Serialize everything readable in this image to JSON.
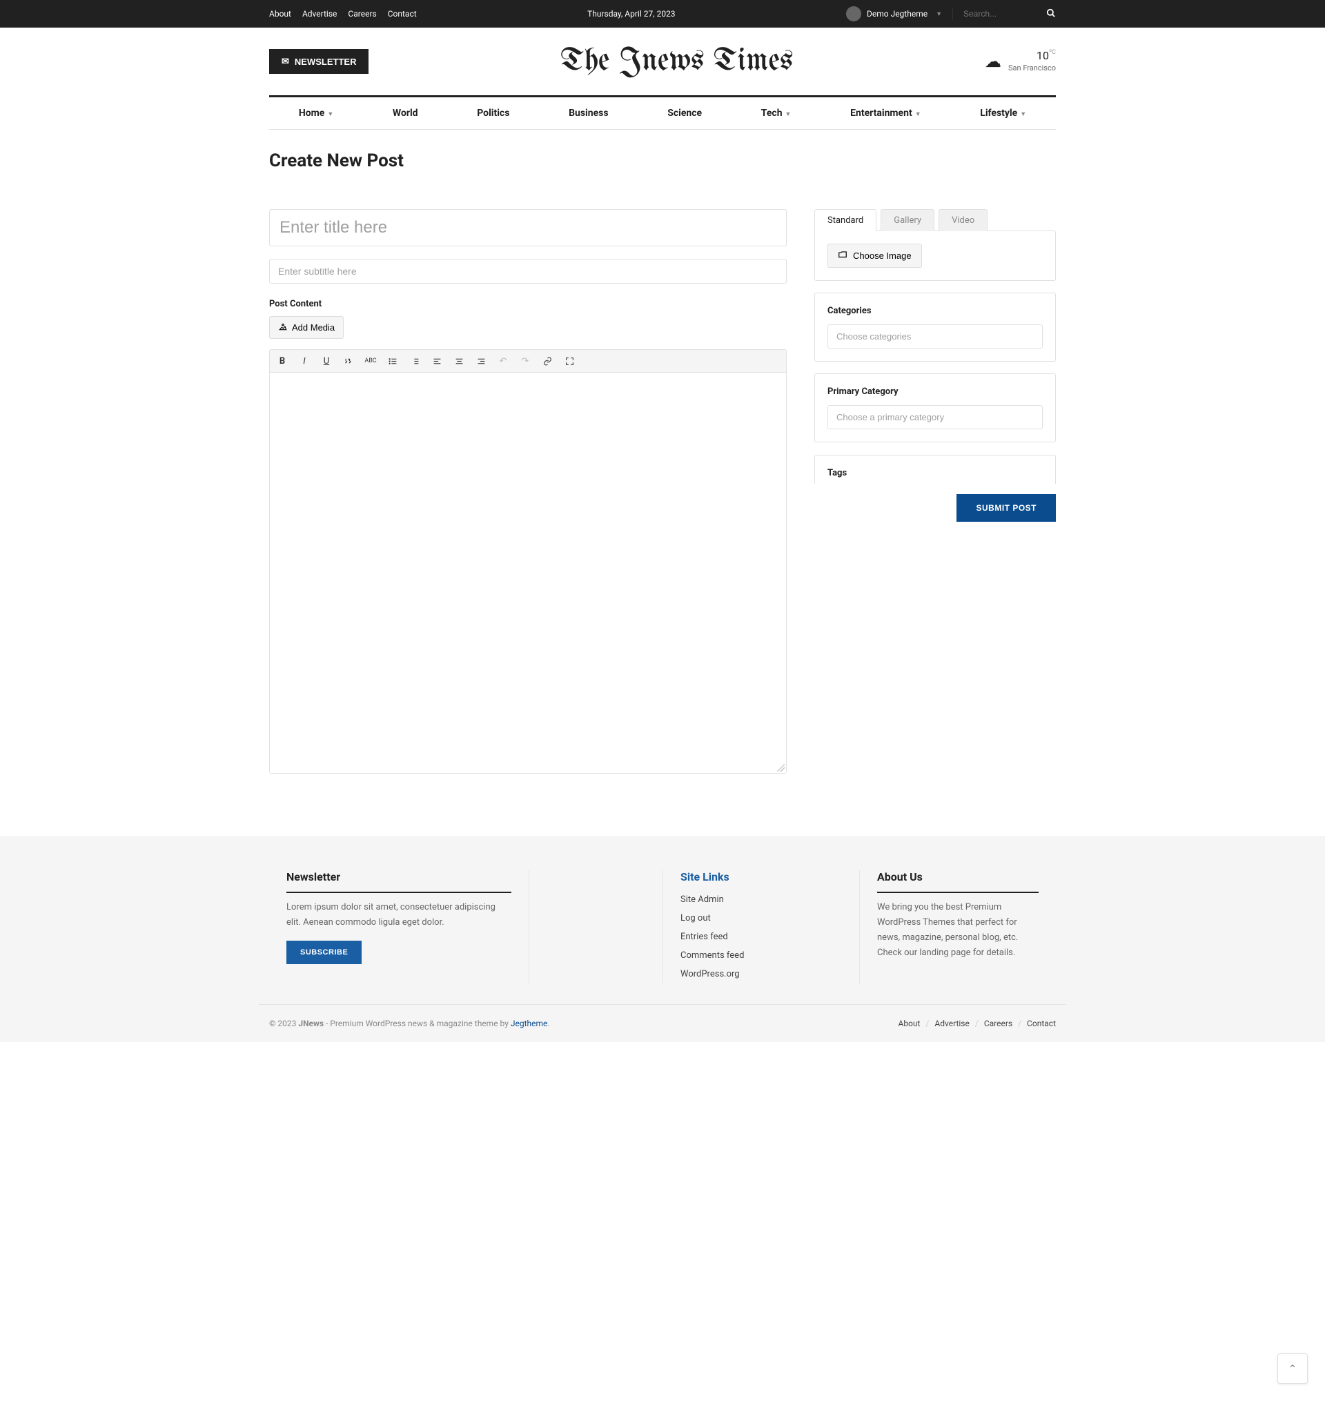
{
  "topbar": {
    "links": [
      "About",
      "Advertise",
      "Careers",
      "Contact"
    ],
    "date": "Thursday, April 27, 2023",
    "username": "Demo Jegtheme",
    "search_placeholder": "Search..."
  },
  "header": {
    "newsletter_btn": "NEWSLETTER",
    "site_title": "The Jnews Times",
    "weather": {
      "temp": "10",
      "unit": "ºC",
      "location": "San Francisco"
    }
  },
  "nav": [
    "Home",
    "World",
    "Politics",
    "Business",
    "Science",
    "Tech",
    "Entertainment",
    "Lifestyle"
  ],
  "nav_dropdowns": [
    true,
    false,
    false,
    false,
    false,
    true,
    true,
    true
  ],
  "page": {
    "heading": "Create New Post",
    "title_placeholder": "Enter title here",
    "subtitle_placeholder": "Enter subtitle here",
    "content_label": "Post Content",
    "add_media": "Add Media",
    "submit": "SUBMIT POST"
  },
  "format_tabs": {
    "standard": "Standard",
    "gallery": "Gallery",
    "video": "Video",
    "choose_image": "Choose Image"
  },
  "side": {
    "categories_label": "Categories",
    "categories_placeholder": "Choose categories",
    "primary_label": "Primary Category",
    "primary_placeholder": "Choose a primary category",
    "tags_label": "Tags"
  },
  "footer": {
    "newsletter_heading": "Newsletter",
    "newsletter_text": "Lorem ipsum dolor sit amet, consectetuer adipiscing elit. Aenean commodo ligula eget dolor.",
    "subscribe": "SUBSCRIBE",
    "sitelinks_heading": "Site Links",
    "sitelinks": [
      "Site Admin",
      "Log out",
      "Entries feed",
      "Comments feed",
      "WordPress.org"
    ],
    "about_heading": "About Us",
    "about_text": "We bring you the best Premium WordPress Themes that perfect for news, magazine, personal blog, etc. Check our landing page for details.",
    "copyright_prefix": "© 2023 ",
    "copyright_brand": "JNews",
    "copyright_mid": " - Premium WordPress news & magazine theme by ",
    "copyright_link": "Jegtheme",
    "bottom_links": [
      "About",
      "Advertise",
      "Careers",
      "Contact"
    ]
  }
}
